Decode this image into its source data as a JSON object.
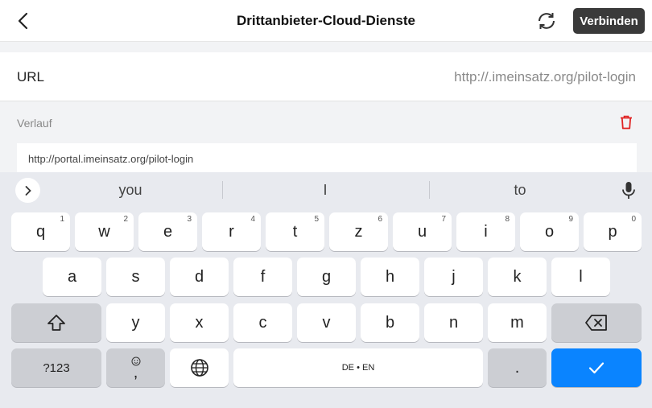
{
  "header": {
    "title": "Drittanbieter-Cloud-Dienste",
    "connect_label": "Verbinden"
  },
  "url_field": {
    "label": "URL",
    "value": "http://.imeinsatz.org/pilot-login"
  },
  "history": {
    "title": "Verlauf",
    "items": [
      "http://portal.imeinsatz.org/pilot-login"
    ]
  },
  "keyboard": {
    "suggestions": [
      "you",
      "I",
      "to"
    ],
    "row1": [
      {
        "key": "q",
        "num": "1"
      },
      {
        "key": "w",
        "num": "2"
      },
      {
        "key": "e",
        "num": "3"
      },
      {
        "key": "r",
        "num": "4"
      },
      {
        "key": "t",
        "num": "5"
      },
      {
        "key": "z",
        "num": "6"
      },
      {
        "key": "u",
        "num": "7"
      },
      {
        "key": "i",
        "num": "8"
      },
      {
        "key": "o",
        "num": "9"
      },
      {
        "key": "p",
        "num": "0"
      }
    ],
    "row2": [
      "a",
      "s",
      "d",
      "f",
      "g",
      "h",
      "j",
      "k",
      "l"
    ],
    "row3": [
      "y",
      "x",
      "c",
      "v",
      "b",
      "n",
      "m"
    ],
    "symbols_label": "?123",
    "comma_label": ",",
    "space_label": "DE • EN",
    "period_label": ".",
    "colors": {
      "enter": "#0a84ff",
      "delete": "#e02424"
    }
  }
}
